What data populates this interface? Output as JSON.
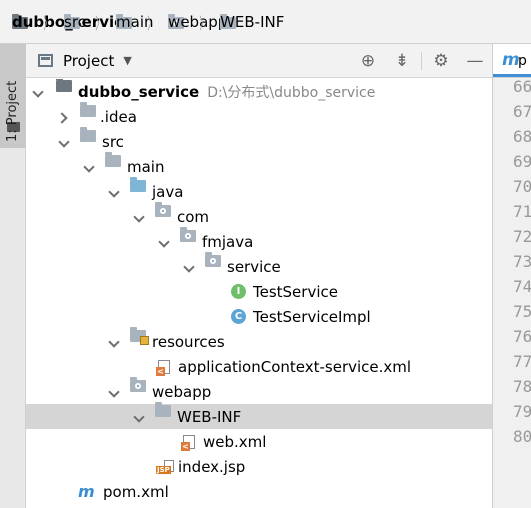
{
  "breadcrumb": {
    "items": [
      {
        "label": "dubbo_service",
        "icon": "project-folder-icon"
      },
      {
        "label": "src",
        "icon": "folder-icon"
      },
      {
        "label": "main",
        "icon": "folder-icon"
      },
      {
        "label": "webapp",
        "icon": "web-folder-icon"
      },
      {
        "label": "WEB-INF",
        "icon": "folder-icon"
      }
    ]
  },
  "toolwindow_stripe": {
    "label": "1: Project"
  },
  "panel": {
    "title": "Project",
    "tools": [
      "locate-icon",
      "collapse-icon",
      "settings-icon",
      "hide-icon"
    ]
  },
  "tree": {
    "root": {
      "label": "dubbo_service",
      "path": "D:\\分布式\\dubbo_service"
    },
    "idea": "idea",
    "src": "src",
    "main": "main",
    "java": "java",
    "com": "com",
    "fmjava": "fmjava",
    "service": "service",
    "TestService": "TestService",
    "TestServiceImpl": "TestServiceImpl",
    "resources": "resources",
    "appctx": "applicationContext-service.xml",
    "webapp": "webapp",
    "webinf": "WEB-INF",
    "webxml": "web.xml",
    "indexjsp": "index.jsp",
    "pom": "pom.xml"
  },
  "editor": {
    "tab_prefix": "p",
    "line_numbers": [
      "66",
      "67",
      "68",
      "69",
      "70",
      "71",
      "72",
      "73",
      "74",
      "75",
      "76",
      "77",
      "78",
      "79",
      "80"
    ]
  },
  "colors": {
    "selection": "#d5d5d5",
    "interface_icon": "#6fbf6a",
    "class_icon": "#5ba6d6",
    "maven_icon": "#3d8fd4"
  }
}
